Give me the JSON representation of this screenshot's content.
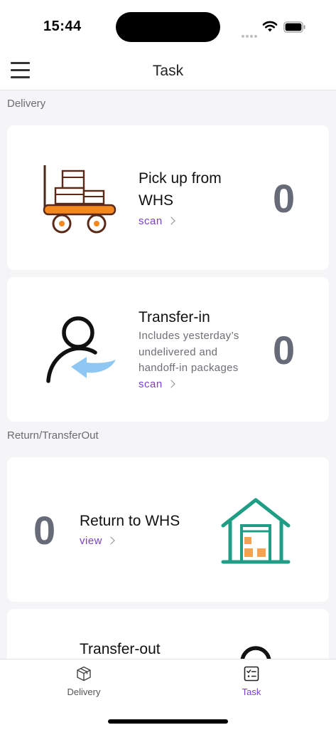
{
  "status_bar": {
    "time": "15:44"
  },
  "header": {
    "title": "Task",
    "menu_icon": "hamburger-menu-icon"
  },
  "sections": [
    {
      "label": "Delivery",
      "cards": [
        {
          "title_line1": "Pick up from",
          "title_line2": "WHS",
          "link_label": "scan",
          "count": "0",
          "icon": "hand-truck-boxes-icon"
        },
        {
          "title": "Transfer-in",
          "desc_lines": [
            "Includes yesterday’s",
            "undelivered and",
            "handoff-in packages"
          ],
          "link_label": "scan",
          "count": "0",
          "icon": "person-transfer-in-icon"
        }
      ]
    },
    {
      "label": "Return/TransferOut",
      "cards": [
        {
          "title": "Return to WHS",
          "link_label": "view",
          "count": "0",
          "icon": "warehouse-icon"
        },
        {
          "title": "Transfer-out",
          "icon": "person-transfer-out-icon"
        }
      ]
    }
  ],
  "tabbar": {
    "tabs": [
      {
        "label": "Delivery",
        "icon": "package-box-icon",
        "active": false
      },
      {
        "label": "Task",
        "icon": "task-checklist-icon",
        "active": true
      }
    ]
  },
  "colors": {
    "accent": "#7a3fd1",
    "count_gray": "#676b77",
    "warehouse_green": "#1f9e85",
    "box_orange": "#f5a350",
    "cart_orange": "#f5871f",
    "arrow_blue": "#8ec7f2"
  }
}
